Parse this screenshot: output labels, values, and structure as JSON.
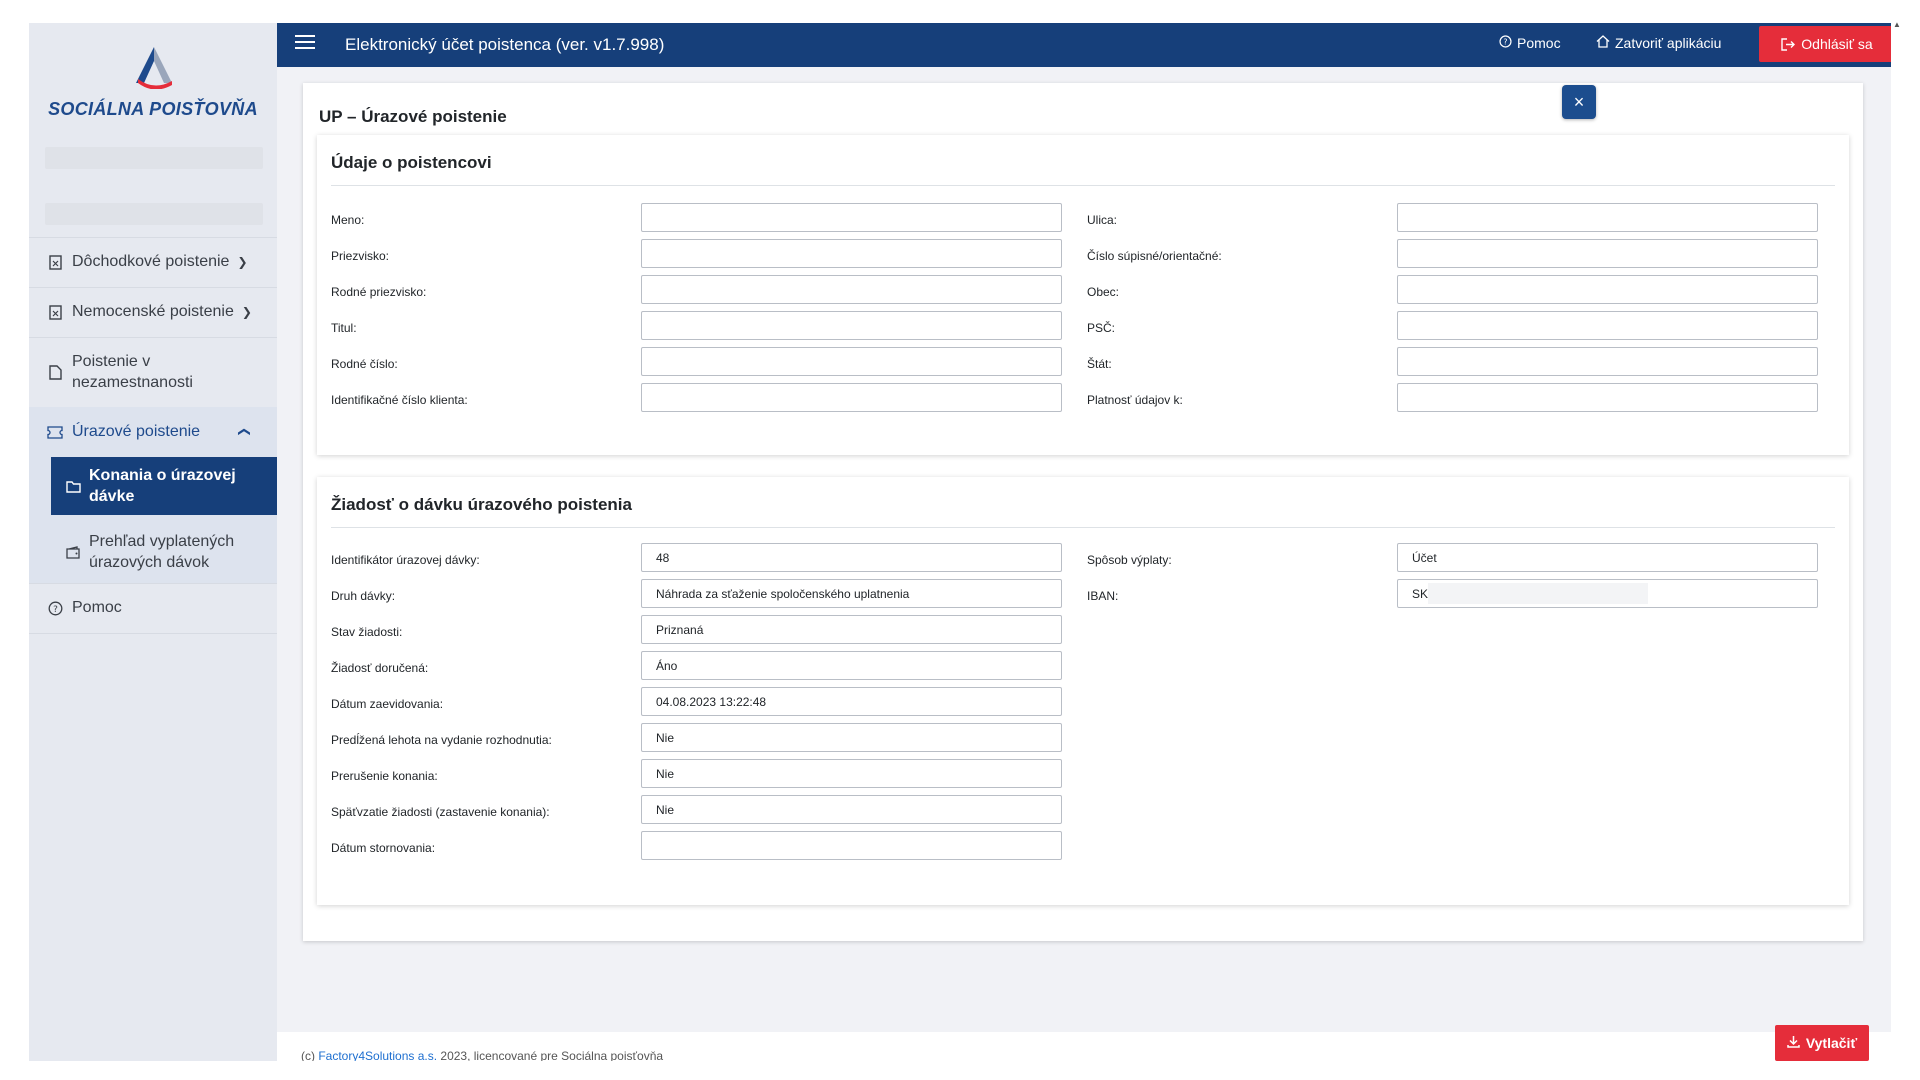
{
  "brand": {
    "logo_text": "SOCIÁLNA POISŤOVŇA",
    "accent": "#163f7a",
    "danger": "#e52d3a"
  },
  "topbar": {
    "title": "Elektronický účet poistenca (ver. v1.7.998)",
    "help_label": "Pomoc",
    "close_app_label": "Zatvoriť aplikáciu",
    "logout_label": "Odhlásiť sa"
  },
  "sidebar": {
    "items": [
      {
        "label": "Dôchodkové poistenie",
        "icon": "document-icon"
      },
      {
        "label": "Nemocenské poistenie",
        "icon": "document-icon"
      },
      {
        "label_line1": "Poistenie v",
        "label_line2": "nezamestnanosti",
        "icon": "file-icon"
      },
      {
        "label": "Úrazové poistenie",
        "icon": "ticket-icon"
      }
    ],
    "subitems": [
      {
        "label_line1": "Konania o úrazovej",
        "label_line2": "dávke",
        "icon": "folder-icon"
      },
      {
        "label_line1": "Prehľad vyplatených",
        "label_line2": "úrazových dávok",
        "icon": "wallet-icon"
      }
    ],
    "help": {
      "label": "Pomoc",
      "icon": "question-circle-icon"
    }
  },
  "page": {
    "title": "UP – Úrazové poistenie",
    "close_symbol": "×"
  },
  "insured": {
    "title": "Údaje o poistencovi",
    "left_fields": [
      {
        "label": "Meno:",
        "value": ""
      },
      {
        "label": "Priezvisko:",
        "value": ""
      },
      {
        "label": "Rodné priezvisko:",
        "value": ""
      },
      {
        "label": "Titul:",
        "value": ""
      },
      {
        "label": "Rodné číslo:",
        "value": ""
      },
      {
        "label": "Identifikačné číslo klienta:",
        "value": ""
      }
    ],
    "right_fields": [
      {
        "label": "Ulica:",
        "value": ""
      },
      {
        "label": "Číslo súpisné/orientačné:",
        "value": ""
      },
      {
        "label": "Obec:",
        "value": ""
      },
      {
        "label": "PSČ:",
        "value": ""
      },
      {
        "label": "Štát:",
        "value": ""
      },
      {
        "label": "Platnosť údajov k:",
        "value": ""
      }
    ]
  },
  "claim": {
    "title": "Žiadosť o dávku úrazového poistenia",
    "left_fields": [
      {
        "label": "Identifikátor úrazovej dávky:",
        "value": "48"
      },
      {
        "label": "Druh dávky:",
        "value": "Náhrada za sťaženie spoločenského uplatnenia"
      },
      {
        "label": "Stav žiadosti:",
        "value": "Priznaná"
      },
      {
        "label": "Žiadosť doručená:",
        "value": "Áno"
      },
      {
        "label": "Dátum zaevidovania:",
        "value": "04.08.2023 13:22:48"
      },
      {
        "label": "Predĺžená lehota na vydanie rozhodnutia:",
        "value": "Nie"
      },
      {
        "label": "Prerušenie konania:",
        "value": "Nie"
      },
      {
        "label": "Späťvzatie žiadosti (zastavenie konania):",
        "value": "Nie"
      },
      {
        "label": "Dátum stornovania:",
        "value": ""
      }
    ],
    "right_fields": [
      {
        "label": "Spôsob výplaty:",
        "value": "Účet"
      },
      {
        "label": "IBAN:",
        "value": "SK"
      }
    ]
  },
  "footer": {
    "prefix": "(c) ",
    "link": "Factory4Solutions a.s.",
    "suffix": " 2023, licencované pre Sociálna poisťovňa"
  },
  "actions": {
    "print_label": "Vytlačiť"
  }
}
